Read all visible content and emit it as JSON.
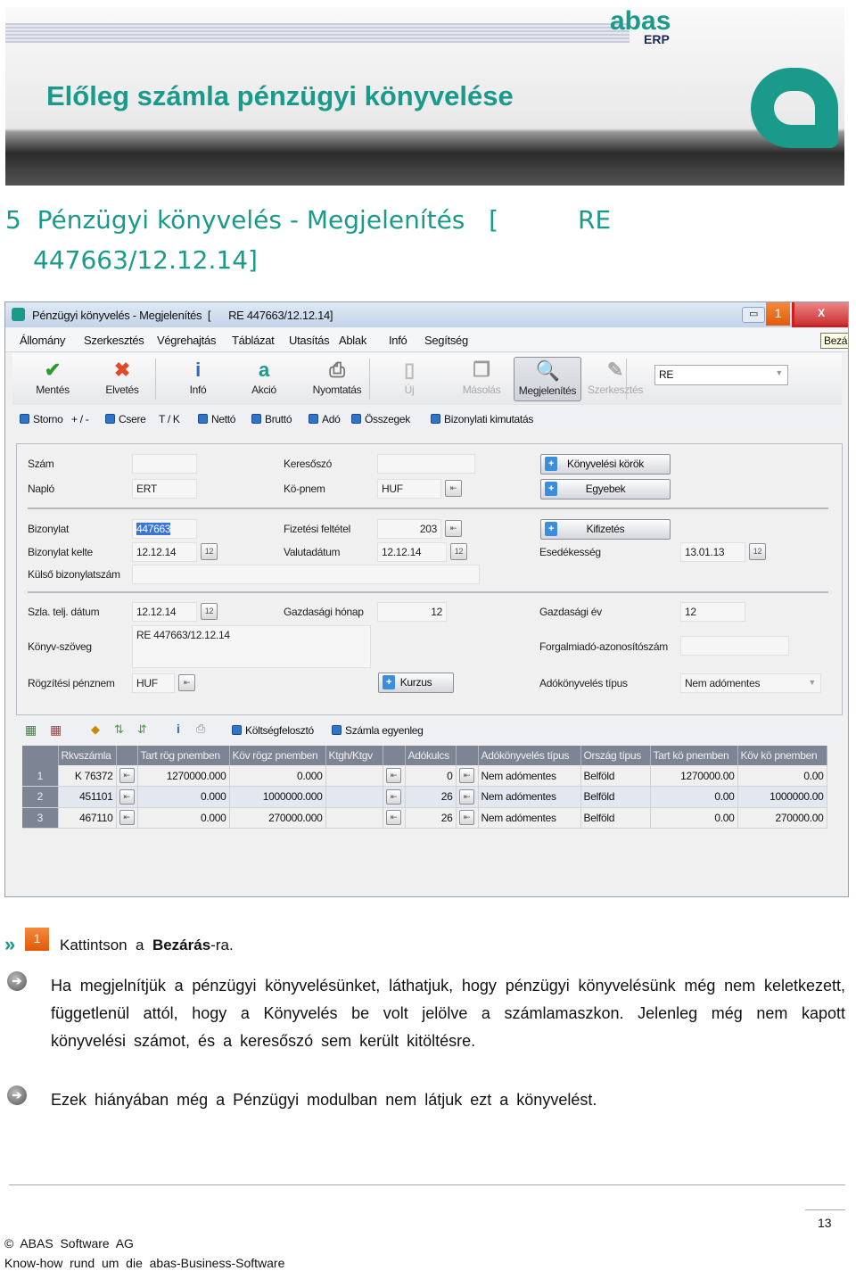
{
  "banner": {
    "title": "Előleg számla pénzügyi könyvelése",
    "logo_text": "abas",
    "logo_sub": "ERP"
  },
  "heading": {
    "line1": "5  Pénzügyi könyvelés - Megjelenítés   [          RE",
    "line2": "447663/12.12.14]"
  },
  "window": {
    "title": "Pénzügyi könyvelés - Megjelenítés  [      RE 447663/12.12.14]",
    "step_badge": "1",
    "close_label": "X",
    "tooltip": "Bezár",
    "menu": [
      "Állomány",
      "Szerkesztés",
      "Végrehajtás",
      "Táblázat",
      "Utasítás",
      "Ablak",
      "Infó",
      "Segítség"
    ],
    "toolbar": [
      {
        "label": "Mentés",
        "icon": "check-icon"
      },
      {
        "label": "Elvetés",
        "icon": "x-icon"
      },
      {
        "label": "Infó",
        "icon": "info-icon"
      },
      {
        "label": "Akció",
        "icon": "abas-a-icon"
      },
      {
        "label": "Nyomtatás",
        "icon": "printer-icon"
      },
      {
        "label": "Új",
        "icon": "new-doc-icon",
        "disabled": true
      },
      {
        "label": "Másolás",
        "icon": "copy-icon",
        "disabled": true
      },
      {
        "label": "Megjelenítés",
        "icon": "magnifier-icon",
        "selected": true
      },
      {
        "label": "Szerkesztés",
        "icon": "edit-icon",
        "disabled": true
      }
    ],
    "type_select": "RE",
    "checkbar": [
      "Storno",
      "+ / -",
      "Csere",
      "T / K",
      "Nettó",
      "Bruttó",
      "Adó",
      "Összegek",
      "Bizonylati kimutatás"
    ],
    "form": {
      "szam": {
        "label": "Szám",
        "value": ""
      },
      "naplo": {
        "label": "Napló",
        "value": "ERT"
      },
      "keresoszo": {
        "label": "Keresőszó",
        "value": ""
      },
      "kopnem": {
        "label": "Kö-pnem",
        "value": "HUF"
      },
      "btn_konyvelesi_korok": "Könyvelési körök",
      "btn_egyebek": "Egyebek",
      "btn_kifizetes": "Kifizetés",
      "btn_kurzus": "Kurzus",
      "bizonylat": {
        "label": "Bizonylat",
        "value": "447663"
      },
      "bizonylat_kelte": {
        "label": "Bizonylat kelte",
        "value": "12.12.14"
      },
      "kulso": {
        "label": "Külső bizonylatszám",
        "value": ""
      },
      "fizetesi": {
        "label": "Fizetési feltétel",
        "value": "203"
      },
      "valutadatum": {
        "label": "Valutadátum",
        "value": "12.12.14"
      },
      "esedekesseg": {
        "label": "Esedékesség",
        "value": "13.01.13"
      },
      "szla_telj": {
        "label": "Szla. telj. dátum",
        "value": "12.12.14"
      },
      "gazd_honap": {
        "label": "Gazdasági hónap",
        "value": "12"
      },
      "gazd_ev": {
        "label": "Gazdasági év",
        "value": "12"
      },
      "konyv_szoveg": {
        "label": "Könyv-szöveg",
        "value": "RE 447663/12.12.14"
      },
      "forgalmi": {
        "label": "Forgalmiadó-azonosítószám",
        "value": ""
      },
      "rogzitesi": {
        "label": "Rögzítési pénznem",
        "value": "HUF"
      },
      "adokonyv": {
        "label": "Adókönyvelés típus",
        "value": "Nem adómentes"
      }
    },
    "table_toolbar": [
      "Költségfelosztó",
      "Számla egyenleg"
    ],
    "table": {
      "columns": [
        "",
        "Rkvszámla",
        "",
        "Tart rög pnemben",
        "Köv rögz pnemben",
        "Ktgh/Ktgv",
        "",
        "Adókulcs",
        "",
        "Adókönyvelés típus",
        "Ország típus",
        "Tart kö pnemben",
        "Köv kö pnemben"
      ],
      "rows": [
        [
          "1",
          "K 76372",
          "1270000.000",
          "0.000",
          "",
          "0",
          "Nem adómentes",
          "Belföld",
          "1270000.00",
          "0.00"
        ],
        [
          "2",
          "451101",
          "0.000",
          "1000000.000",
          "",
          "26",
          "Nem adómentes",
          "Belföld",
          "0.00",
          "1000000.00"
        ],
        [
          "3",
          "467110",
          "0.000",
          "270000.000",
          "",
          "26",
          "Nem adómentes",
          "Belföld",
          "0.00",
          "270000.00"
        ]
      ]
    }
  },
  "step": {
    "badge": "1",
    "pre": "Kattintson  a  ",
    "bold": "Bezárás",
    "post": "-ra."
  },
  "note1": "Ha megjelnítjük a pénzügyi könyvelésünket, láthatjuk, hogy pénzügyi könyvelésünk még nem keletkezett, függetlenül attól, hogy a Könyvelés be volt jelölve a számlamaszkon. Jelenleg még nem kapott könyvelési számot, és a keresőszó sem került kitöltésre.",
  "note2": "Ezek hiányában még a Pénzügyi modulban nem látjuk ezt a könyvelést.",
  "footer": {
    "page": "13",
    "copyright": "©  ABAS  Software  AG",
    "tagline": "Know-how  rund  um  die  abas-Business-Software"
  },
  "colors": {
    "accent": "#1a9a8a",
    "step_badge": "#e8661a",
    "close_highlight": "#cc1f1f"
  }
}
